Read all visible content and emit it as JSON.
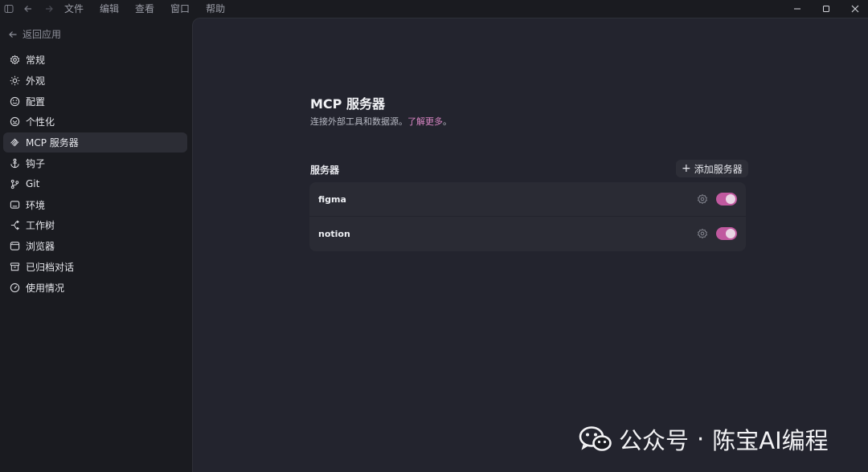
{
  "titlebar": {
    "menu": [
      "文件",
      "编辑",
      "查看",
      "窗口",
      "帮助"
    ]
  },
  "sidebar": {
    "back_label": "返回应用",
    "items": [
      {
        "label": "常规",
        "icon": "gear-icon"
      },
      {
        "label": "外观",
        "icon": "sun-icon"
      },
      {
        "label": "配置",
        "icon": "config-icon"
      },
      {
        "label": "个性化",
        "icon": "personalize-icon"
      },
      {
        "label": "MCP 服务器",
        "icon": "mcp-icon",
        "active": true
      },
      {
        "label": "钩子",
        "icon": "anchor-icon"
      },
      {
        "label": "Git",
        "icon": "git-branch-icon"
      },
      {
        "label": "环境",
        "icon": "monitor-icon"
      },
      {
        "label": "工作树",
        "icon": "worktree-icon"
      },
      {
        "label": "浏览器",
        "icon": "browser-icon"
      },
      {
        "label": "已归档对话",
        "icon": "archive-icon"
      },
      {
        "label": "使用情况",
        "icon": "gauge-icon"
      }
    ]
  },
  "main": {
    "title": "MCP 服务器",
    "subtitle": "连接外部工具和数据源。",
    "learn_more": "了解更多",
    "subtitle_end": "。",
    "section_title": "服务器",
    "add_button": "添加服务器",
    "servers": [
      {
        "name": "figma",
        "enabled": true
      },
      {
        "name": "notion",
        "enabled": true
      }
    ]
  },
  "watermark": {
    "prefix": "公众号",
    "separator": "·",
    "name": "陈宝AI编程"
  },
  "colors": {
    "accent": "#c0599f",
    "link": "#d986c4",
    "sidebar_bg": "#1a1b20",
    "main_bg": "#23242e"
  }
}
